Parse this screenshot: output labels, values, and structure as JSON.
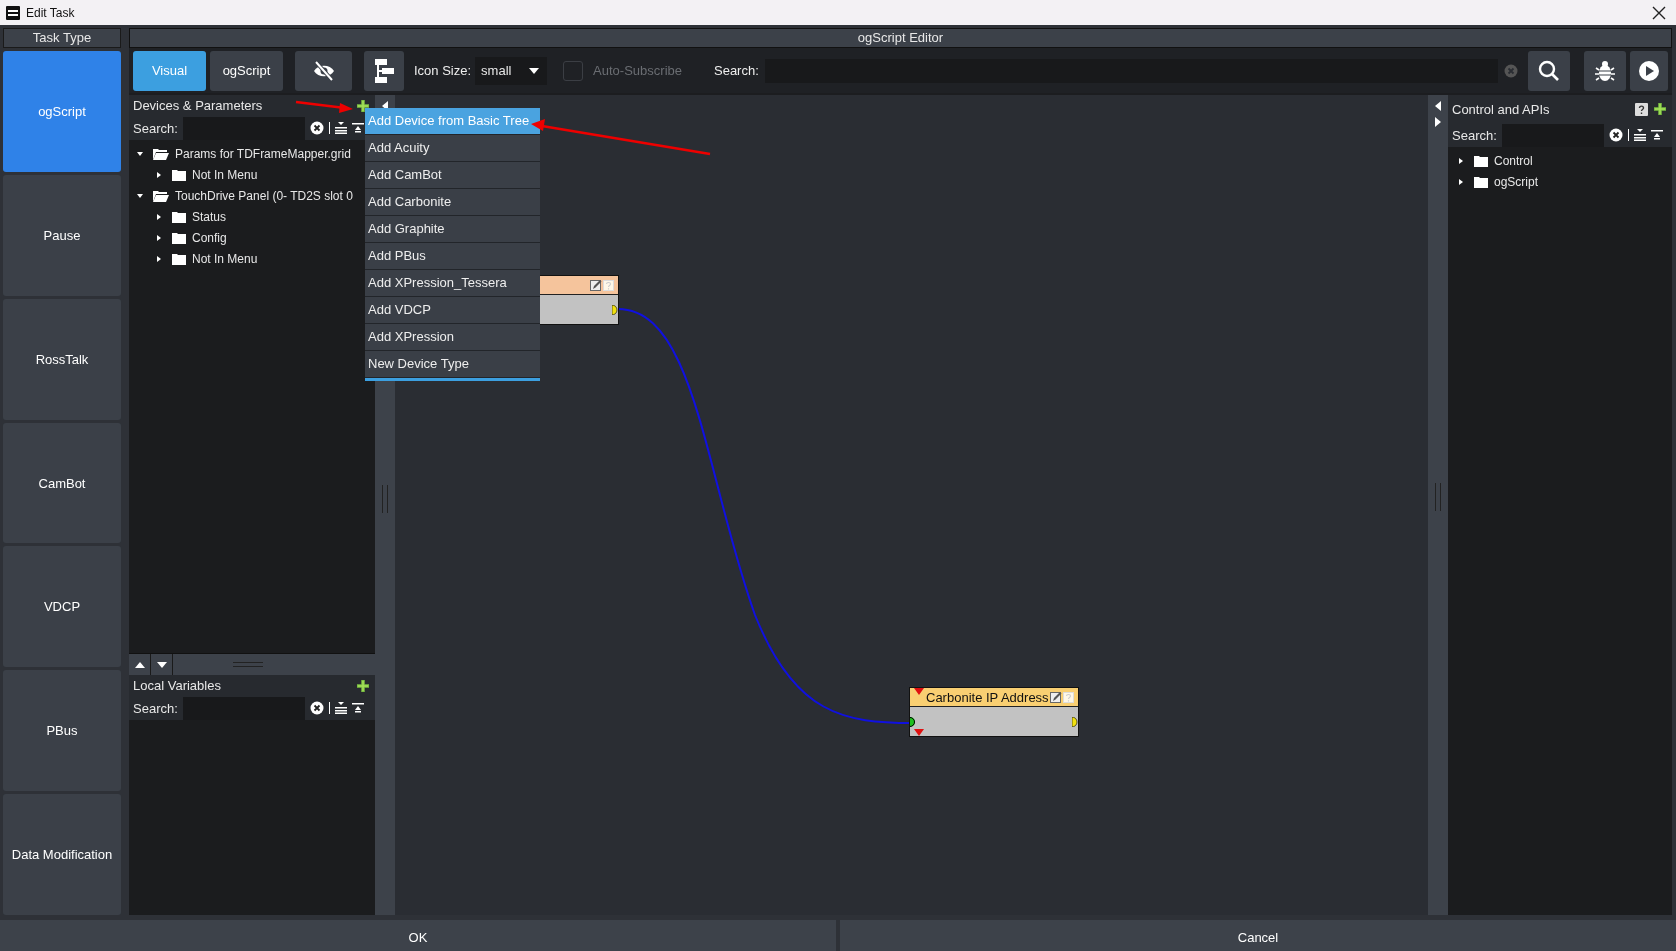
{
  "window": {
    "title": "Edit Task"
  },
  "task_type": {
    "title": "Task Type",
    "items": [
      {
        "label": "ogScript",
        "selected": true
      },
      {
        "label": "Pause",
        "selected": false
      },
      {
        "label": "RossTalk",
        "selected": false
      },
      {
        "label": "CamBot",
        "selected": false
      },
      {
        "label": "VDCP",
        "selected": false
      },
      {
        "label": "PBus",
        "selected": false
      },
      {
        "label": "Data Modification",
        "selected": false
      }
    ]
  },
  "editor": {
    "title": "ogScript Editor",
    "modes": [
      {
        "label": "Visual",
        "selected": true
      },
      {
        "label": "ogScript",
        "selected": false
      }
    ],
    "icon_size": {
      "label": "Icon Size:",
      "value": "small"
    },
    "auto_subscribe": {
      "label": "Auto-Subscribe",
      "checked": false,
      "disabled": true
    },
    "search": {
      "label": "Search:"
    }
  },
  "devices_panel": {
    "title": "Devices & Parameters",
    "search_label": "Search:",
    "tree": [
      {
        "label": "Params for TDFrameMapper.grid",
        "expanded": true,
        "children": [
          {
            "label": "Not In Menu",
            "expanded": false
          }
        ]
      },
      {
        "label": "TouchDrive Panel (0- TD2S slot 0",
        "expanded": true,
        "children": [
          {
            "label": "Status",
            "expanded": false
          },
          {
            "label": "Config",
            "expanded": false
          },
          {
            "label": "Not In Menu",
            "expanded": false
          }
        ]
      }
    ]
  },
  "local_variables": {
    "title": "Local Variables",
    "search_label": "Search:"
  },
  "apis_panel": {
    "title": "Control and APIs",
    "search_label": "Search:",
    "tree": [
      {
        "label": "Control",
        "expanded": false
      },
      {
        "label": "ogScript",
        "expanded": false
      }
    ]
  },
  "context_menu": {
    "items": [
      {
        "label": "Add Device from Basic Tree",
        "selected": true
      },
      {
        "label": "Add Acuity",
        "selected": false
      },
      {
        "label": "Add CamBot",
        "selected": false
      },
      {
        "label": "Add Carbonite",
        "selected": false
      },
      {
        "label": "Add Graphite",
        "selected": false
      },
      {
        "label": "Add PBus",
        "selected": false
      },
      {
        "label": "Add XPression_Tessera",
        "selected": false
      },
      {
        "label": "Add VDCP",
        "selected": false
      },
      {
        "label": "Add XPression",
        "selected": false
      },
      {
        "label": "New Device Type",
        "selected": false
      }
    ]
  },
  "canvas": {
    "nodes": [
      {
        "kind": "node",
        "color": "#f5c49c"
      },
      {
        "kind": "node",
        "color": "#f9cf72",
        "title": "Carbonite IP Address"
      }
    ]
  },
  "buttons": [
    {
      "label": "OK"
    },
    {
      "label": "Cancel"
    }
  ]
}
